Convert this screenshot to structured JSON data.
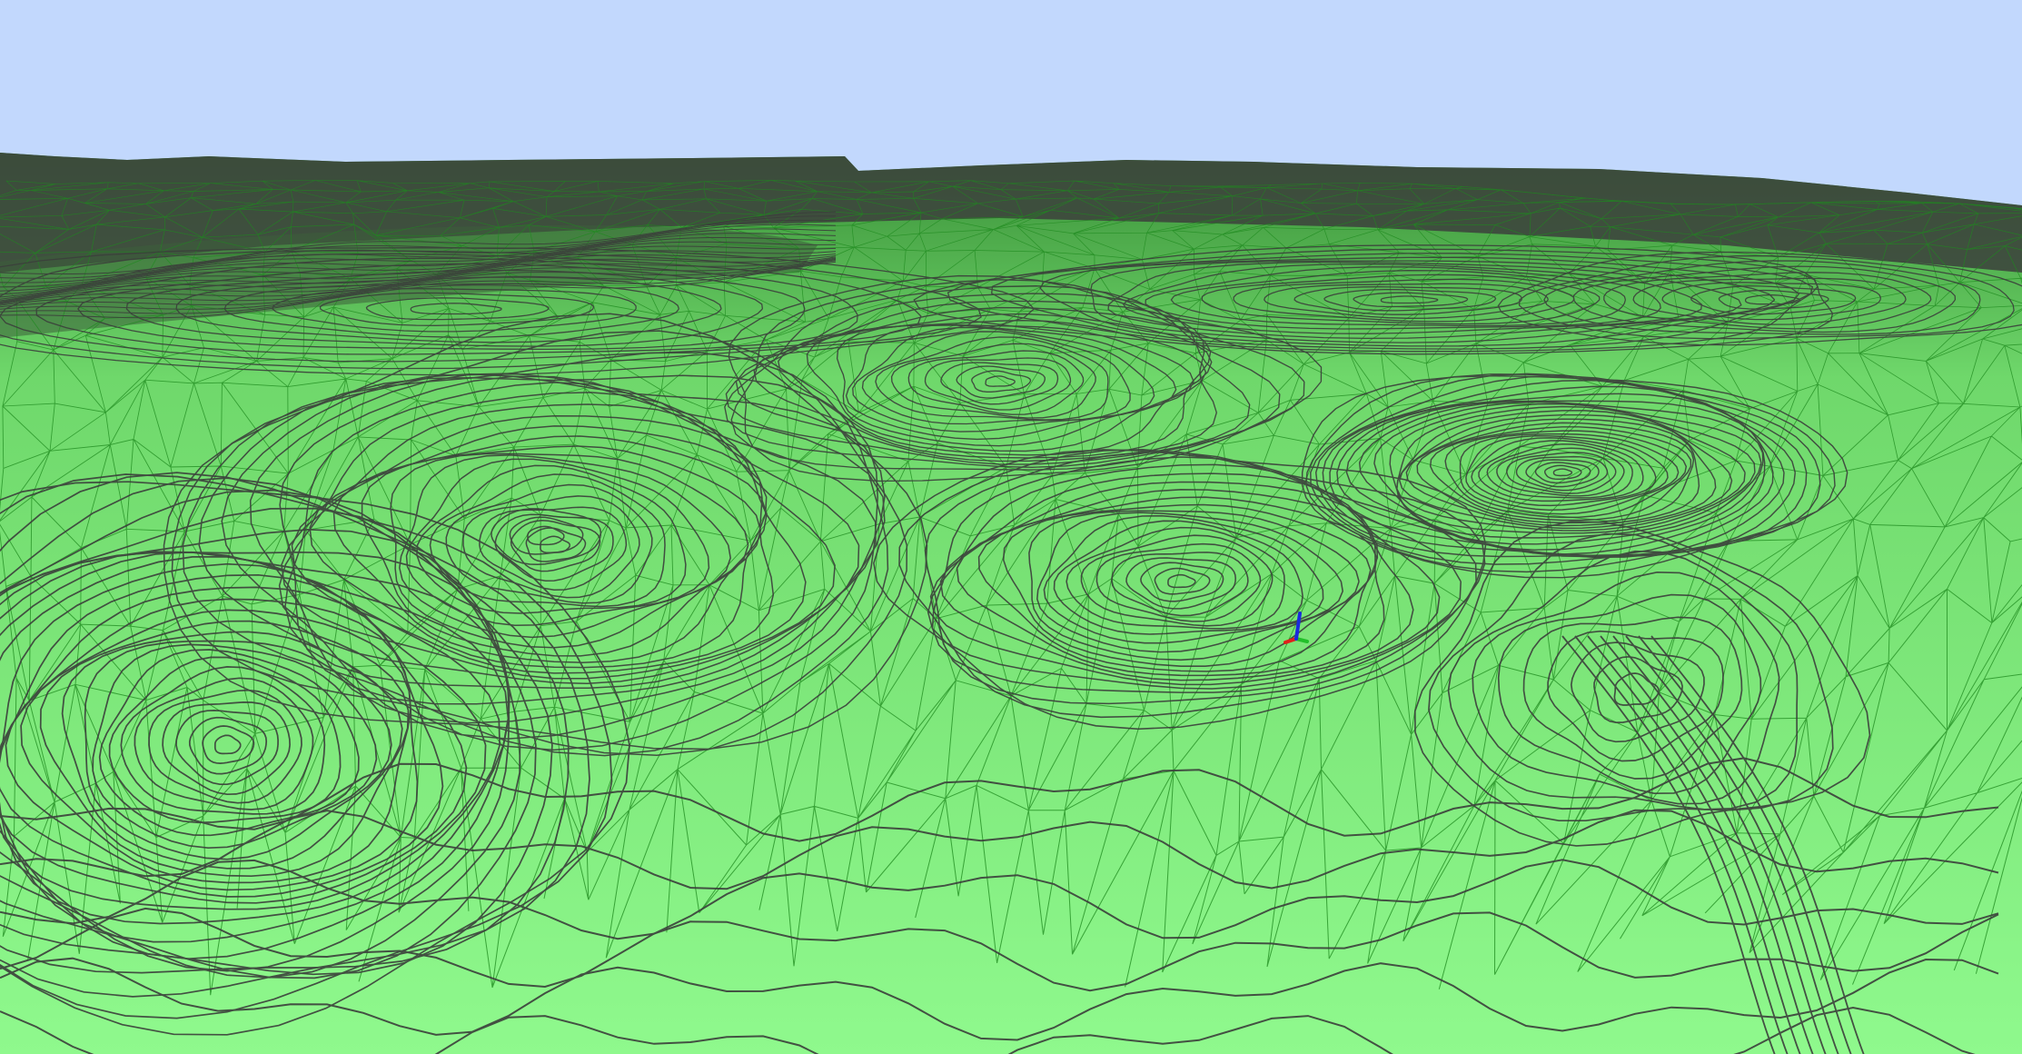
{
  "scene": {
    "sky_color": "#c2d8fd",
    "terrain_fill_near": "#8ff98d",
    "terrain_fill_far": "#4fb84c",
    "contour_line_color": "#3b3f3b",
    "triangle_edge_color": "#1e8a1e",
    "distant_ridge_color": "#3c3f3c",
    "axis_colors": {
      "x": "#e0201a",
      "y": "#22c02a",
      "z": "#1a2bdc"
    },
    "icons": [
      "axis-gizmo-icon"
    ]
  }
}
